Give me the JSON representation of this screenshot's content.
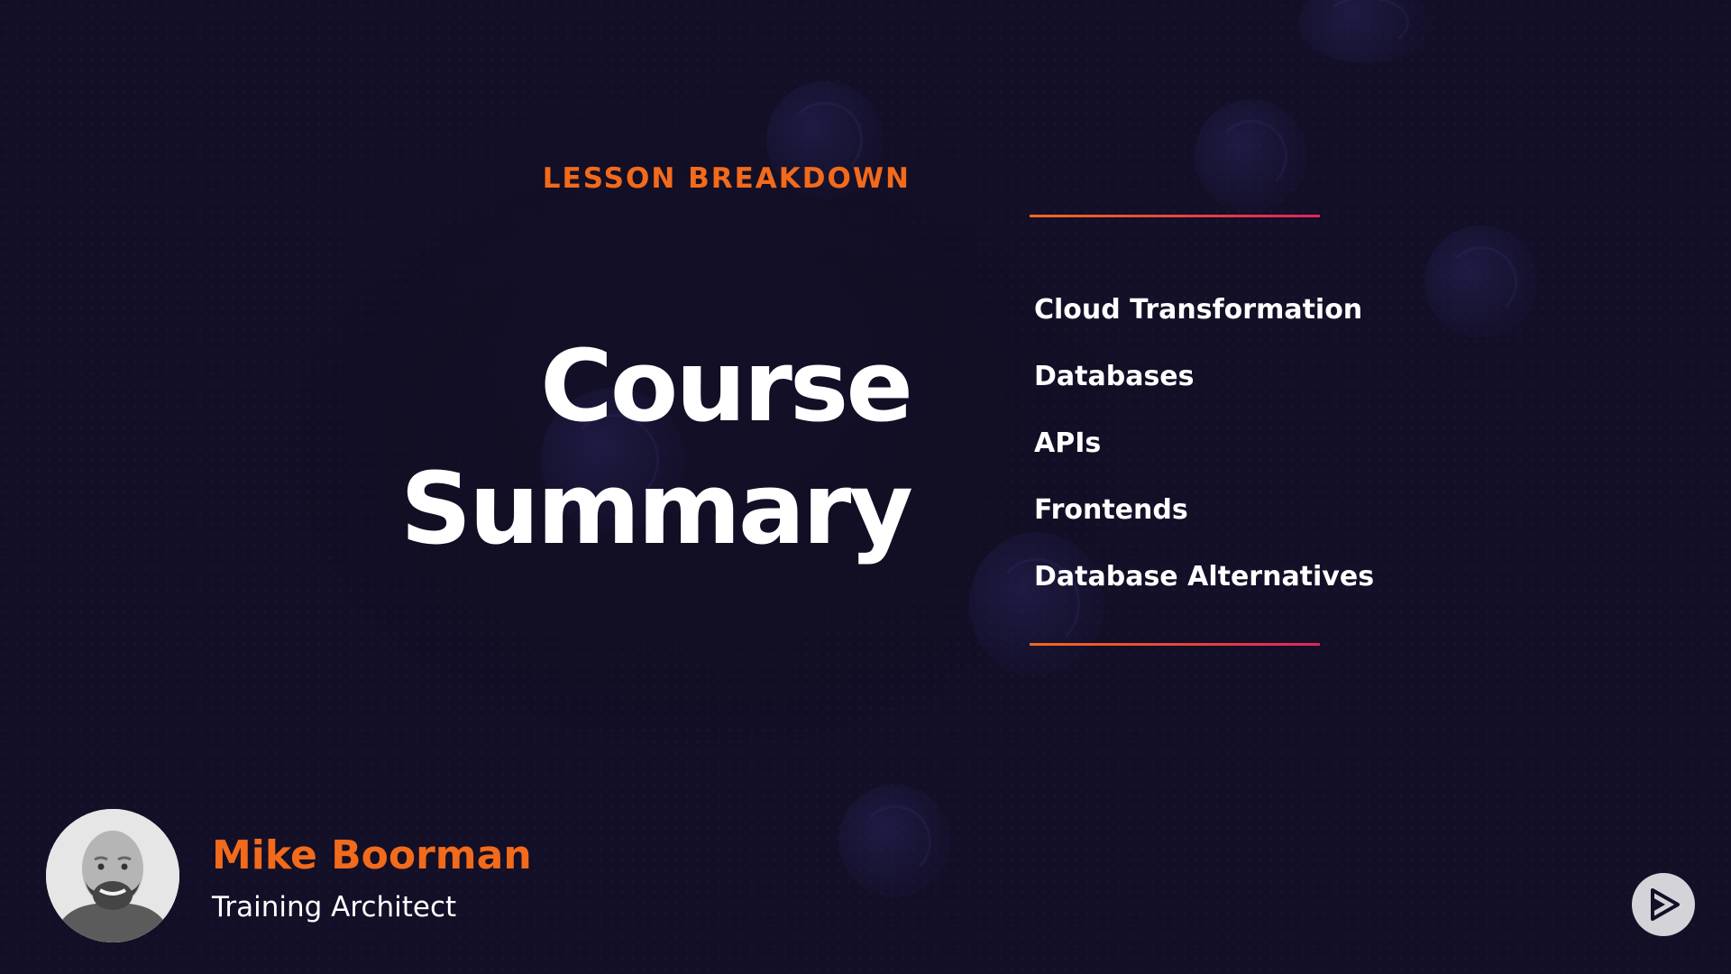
{
  "slide": {
    "eyebrow": "LESSON BREAKDOWN",
    "title_lines": [
      "Course",
      "Summary"
    ]
  },
  "topics": [
    "Cloud Transformation",
    "Databases",
    "APIs",
    "Frontends",
    "Database Alternatives"
  ],
  "presenter": {
    "name": "Mike Boorman",
    "role": "Training Architect"
  },
  "icons": {
    "play": "play-icon",
    "avatar": "presenter-photo"
  },
  "colors": {
    "background": "#130f26",
    "accent_orange": "#f26a1b",
    "accent_pink": "#e0245e",
    "text": "#ffffff"
  }
}
